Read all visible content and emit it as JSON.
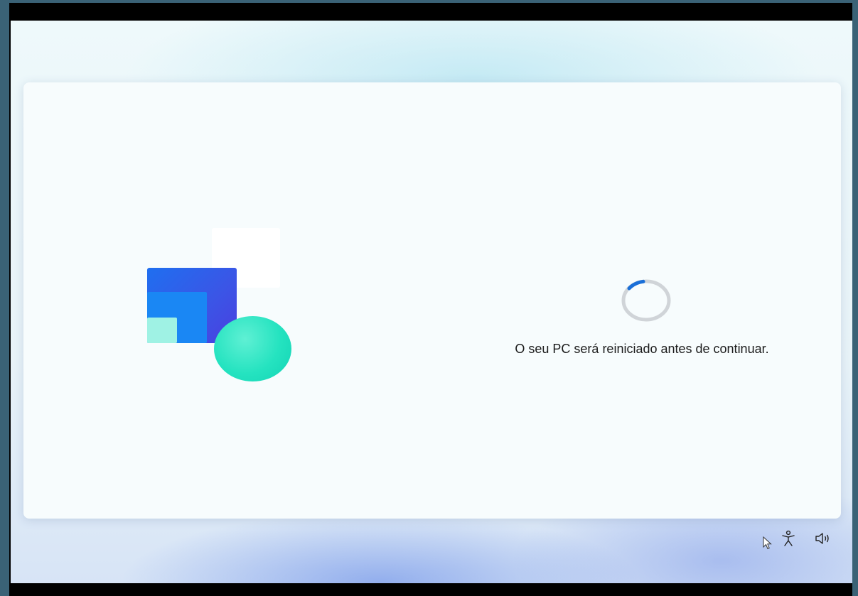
{
  "status": {
    "message": "O seu PC será reiniciado antes de continuar."
  },
  "system_icons": [
    "accessibility-icon",
    "volume-icon"
  ],
  "colors": {
    "spinner_accent": "#1a6fd8",
    "spinner_track": "#d0d4d8",
    "illustration_blue": "#1f6ff0",
    "illustration_mint": "#25e3c0"
  }
}
